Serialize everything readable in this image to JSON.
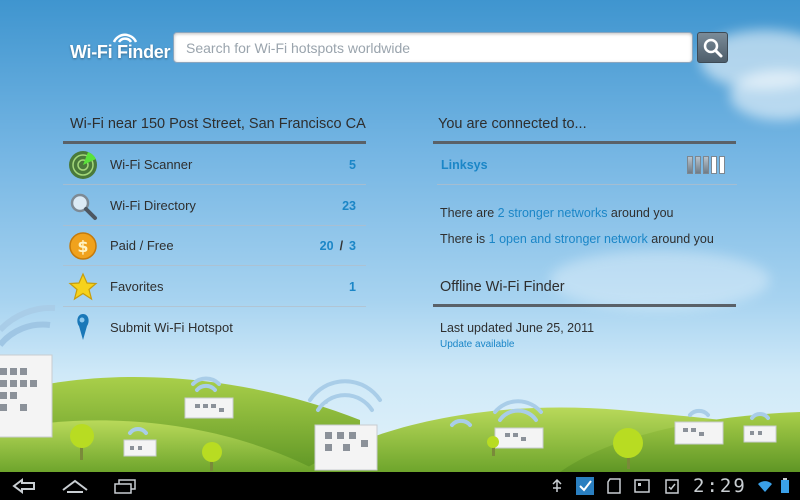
{
  "header": {
    "logo_text": "Wi-Fi Finder",
    "search_placeholder": "Search for Wi-Fi hotspots worldwide",
    "search_value": ""
  },
  "nearby": {
    "title": "Wi-Fi near 150 Post Street, San Francisco CA",
    "items": [
      {
        "label": "Wi-Fi Scanner",
        "count": "5",
        "icon": "radar-icon"
      },
      {
        "label": "Wi-Fi Directory",
        "count": "23",
        "icon": "magnifier-icon"
      },
      {
        "label": "Paid / Free",
        "paid": "20",
        "separator": "/",
        "free": "3",
        "icon": "coin-icon"
      },
      {
        "label": "Favorites",
        "count": "1",
        "icon": "star-icon"
      },
      {
        "label": "Submit Wi-Fi Hotspot",
        "icon": "map-pin-icon"
      }
    ]
  },
  "connection": {
    "title": "You are connected to...",
    "network_name": "Linksys",
    "signal_level": "3/5",
    "line1_prefix": "There are ",
    "line1_link": "2 stronger networks",
    "line1_suffix": " around you",
    "line2_prefix": "There is ",
    "line2_link": "1 open and stronger network",
    "line2_suffix": " around you"
  },
  "offline": {
    "title": "Offline Wi-Fi Finder",
    "last_updated": "Last updated June 25, 2011",
    "update_link": "Update available"
  },
  "statusbar": {
    "clock": "2:29",
    "icons": [
      "back-icon",
      "home-icon",
      "recent-apps-icon",
      "usb-debug-icon",
      "download-icon",
      "sd-card-icon",
      "screenshot-icon",
      "clipboard-icon",
      "wifi-icon",
      "battery-icon"
    ]
  },
  "colors": {
    "link": "#1b86c7",
    "rule": "#5a6168",
    "text": "#2f2f2f",
    "statusbar": "#000000"
  }
}
